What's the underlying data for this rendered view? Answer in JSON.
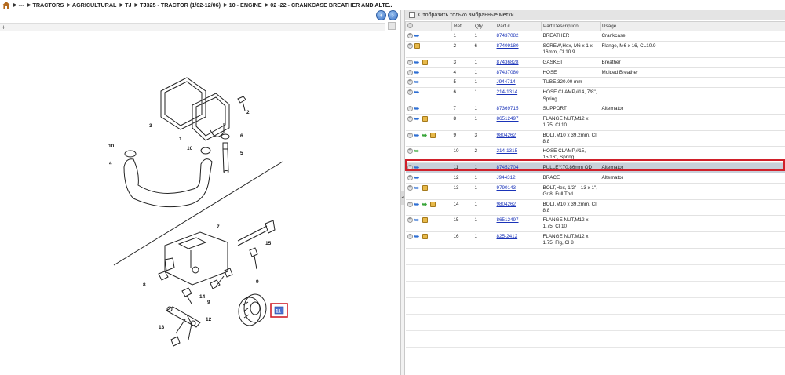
{
  "breadcrumb": {
    "items": [
      "---",
      "TRACTORS",
      "AGRICULTURAL",
      "TJ",
      "TJ325 - TRACTOR (1/02-12/06)",
      "10 - ENGINE",
      "02 -22 - CRANKCASE BREATHER AND ALTE..."
    ]
  },
  "icons": {
    "home": "home-icon",
    "back": "arrow-left-icon",
    "forward": "arrow-right-icon",
    "zoom": "plus-icon",
    "splitter": "chevron-left-icon"
  },
  "colors": {
    "accent_blue": "#3b73c8",
    "selection_red": "#d0202a",
    "selected_row": "#c8d0da",
    "link": "#1a33b8"
  },
  "filter": {
    "label": "Отобразить только выбранные метки"
  },
  "table": {
    "headers": [
      "Ref",
      "Qty",
      "Part #",
      "Part Description",
      "Usage"
    ],
    "rows": [
      {
        "ref": "1",
        "qty": "1",
        "part": "87437082",
        "desc": "BREATHER",
        "usage": "Crankcase",
        "icons": [
          "blue"
        ],
        "tall": false
      },
      {
        "ref": "2",
        "qty": "6",
        "part": "87409180",
        "desc": "SCREW,Hex, M6 x 1 x 16mm, Cl 10.9",
        "usage": "Flange, M6 x 16, CL10.9",
        "icons": [
          "box"
        ],
        "tall": true
      },
      {
        "ref": "3",
        "qty": "1",
        "part": "87436828",
        "desc": "GASKET",
        "usage": "Breather",
        "icons": [
          "blue",
          "box"
        ],
        "tall": false
      },
      {
        "ref": "4",
        "qty": "1",
        "part": "87437080",
        "desc": "HOSE",
        "usage": "Molded Breather",
        "icons": [
          "blue"
        ],
        "tall": false
      },
      {
        "ref": "5",
        "qty": "1",
        "part": "J944714",
        "desc": "TUBE,320.00 mm",
        "usage": "",
        "icons": [
          "blue"
        ],
        "tall": false
      },
      {
        "ref": "6",
        "qty": "1",
        "part": "214-1314",
        "desc": "HOSE CLAMP,#14, 7/8\", Spring",
        "usage": "",
        "icons": [
          "blue"
        ],
        "tall": true
      },
      {
        "ref": "7",
        "qty": "1",
        "part": "87369715",
        "desc": "SUPPORT",
        "usage": "Alternator",
        "icons": [
          "blue"
        ],
        "tall": false
      },
      {
        "ref": "8",
        "qty": "1",
        "part": "86512497",
        "desc": "FLANGE NUT,M12 x 1.75, Cl 10",
        "usage": "",
        "icons": [
          "blue",
          "box"
        ],
        "tall": true
      },
      {
        "ref": "9",
        "qty": "3",
        "part": "9804262",
        "desc": "BOLT,M10 x 39.2mm, Cl 8.8",
        "usage": "",
        "icons": [
          "blue",
          "green",
          "box"
        ],
        "tall": false
      },
      {
        "ref": "10",
        "qty": "2",
        "part": "214-1315",
        "desc": "HOSE CLAMP,#15, 15/16\", Spring",
        "usage": "",
        "icons": [
          "green"
        ],
        "tall": true
      },
      {
        "ref": "11",
        "qty": "1",
        "part": "87452704",
        "desc": "PULLEY,70.86mm OD",
        "usage": "Alternator",
        "icons": [
          "blue"
        ],
        "tall": false,
        "selected": true
      },
      {
        "ref": "12",
        "qty": "1",
        "part": "J944312",
        "desc": "BRACE",
        "usage": "Alternator",
        "icons": [
          "blue"
        ],
        "tall": false
      },
      {
        "ref": "13",
        "qty": "1",
        "part": "9790143",
        "desc": "BOLT,Hex, 1/2\" - 13 x 1\", Gr 8, Full Thd",
        "usage": "",
        "icons": [
          "blue",
          "box"
        ],
        "tall": true
      },
      {
        "ref": "14",
        "qty": "1",
        "part": "9804262",
        "desc": "BOLT,M10 x 39.2mm, Cl 8.8",
        "usage": "",
        "icons": [
          "blue",
          "green",
          "box"
        ],
        "tall": false
      },
      {
        "ref": "15",
        "qty": "1",
        "part": "86512497",
        "desc": "FLANGE NUT,M12 x 1.75, Cl 10",
        "usage": "",
        "icons": [
          "blue",
          "box"
        ],
        "tall": true
      },
      {
        "ref": "16",
        "qty": "1",
        "part": "825-2412",
        "desc": "FLANGE NUT,M12 x 1.75, Flg, Cl 8",
        "usage": "",
        "icons": [
          "blue",
          "box"
        ],
        "tall": true
      }
    ]
  },
  "diagram": {
    "callouts": [
      "1",
      "2",
      "3",
      "4",
      "5",
      "6",
      "7",
      "8",
      "9",
      "9",
      "10",
      "10",
      "11",
      "12",
      "13",
      "14",
      "15"
    ],
    "highlighted_callout": "11"
  }
}
